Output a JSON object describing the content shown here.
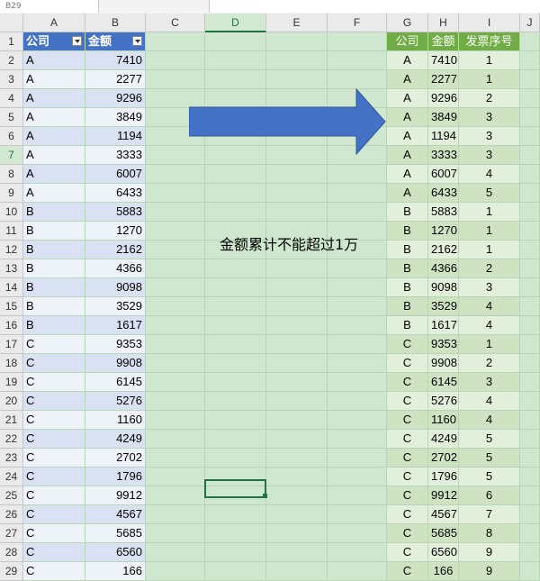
{
  "namebox": "B29",
  "columns": [
    "A",
    "B",
    "C",
    "D",
    "E",
    "F",
    "G",
    "H",
    "I",
    "J"
  ],
  "left_table": {
    "headers": [
      "公司",
      "金额"
    ],
    "rows": [
      [
        "A",
        "7410"
      ],
      [
        "A",
        "2277"
      ],
      [
        "A",
        "9296"
      ],
      [
        "A",
        "3849"
      ],
      [
        "A",
        "1194"
      ],
      [
        "A",
        "3333"
      ],
      [
        "A",
        "6007"
      ],
      [
        "A",
        "6433"
      ],
      [
        "B",
        "5883"
      ],
      [
        "B",
        "1270"
      ],
      [
        "B",
        "2162"
      ],
      [
        "B",
        "4366"
      ],
      [
        "B",
        "9098"
      ],
      [
        "B",
        "3529"
      ],
      [
        "B",
        "1617"
      ],
      [
        "C",
        "9353"
      ],
      [
        "C",
        "9908"
      ],
      [
        "C",
        "6145"
      ],
      [
        "C",
        "5276"
      ],
      [
        "C",
        "1160"
      ],
      [
        "C",
        "4249"
      ],
      [
        "C",
        "2702"
      ],
      [
        "C",
        "1796"
      ],
      [
        "C",
        "9912"
      ],
      [
        "C",
        "4567"
      ],
      [
        "C",
        "5685"
      ],
      [
        "C",
        "6560"
      ],
      [
        "C",
        "166"
      ]
    ]
  },
  "right_table": {
    "headers": [
      "公司",
      "金额",
      "发票序号"
    ],
    "rows": [
      [
        "A",
        "7410",
        "1"
      ],
      [
        "A",
        "2277",
        "1"
      ],
      [
        "A",
        "9296",
        "2"
      ],
      [
        "A",
        "3849",
        "3"
      ],
      [
        "A",
        "1194",
        "3"
      ],
      [
        "A",
        "3333",
        "3"
      ],
      [
        "A",
        "6007",
        "4"
      ],
      [
        "A",
        "6433",
        "5"
      ],
      [
        "B",
        "5883",
        "1"
      ],
      [
        "B",
        "1270",
        "1"
      ],
      [
        "B",
        "2162",
        "1"
      ],
      [
        "B",
        "4366",
        "2"
      ],
      [
        "B",
        "9098",
        "3"
      ],
      [
        "B",
        "3529",
        "4"
      ],
      [
        "B",
        "1617",
        "4"
      ],
      [
        "C",
        "9353",
        "1"
      ],
      [
        "C",
        "9908",
        "2"
      ],
      [
        "C",
        "6145",
        "3"
      ],
      [
        "C",
        "5276",
        "4"
      ],
      [
        "C",
        "1160",
        "4"
      ],
      [
        "C",
        "4249",
        "5"
      ],
      [
        "C",
        "2702",
        "5"
      ],
      [
        "C",
        "1796",
        "5"
      ],
      [
        "C",
        "9912",
        "6"
      ],
      [
        "C",
        "4567",
        "7"
      ],
      [
        "C",
        "5685",
        "8"
      ],
      [
        "C",
        "6560",
        "9"
      ],
      [
        "C",
        "166",
        "9"
      ]
    ]
  },
  "caption": "金额累计不能超过1万",
  "colors": {
    "left_header": "#4472c4",
    "right_header": "#70ad47",
    "arrow": "#4472c4",
    "selection": "#217346"
  }
}
